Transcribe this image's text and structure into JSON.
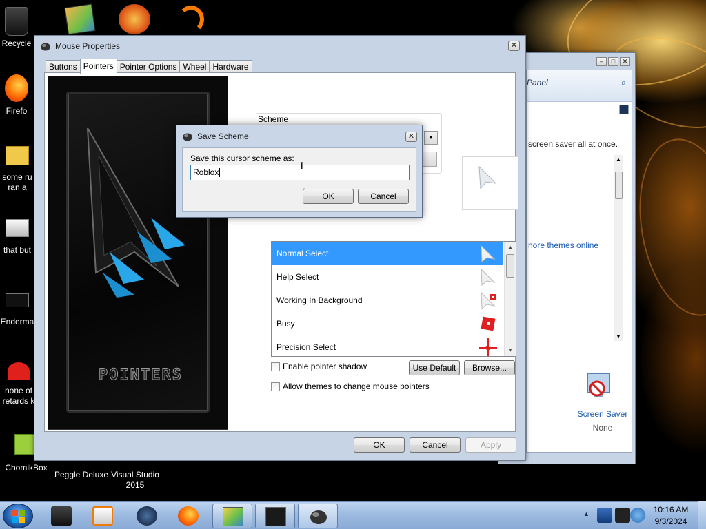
{
  "desktop": {
    "icons": [
      {
        "name": "recycle-bin",
        "label": "Recycle"
      },
      {
        "name": "firefox",
        "label": "Firefo"
      },
      {
        "name": "folder-1",
        "label": "some ru\nran a"
      },
      {
        "name": "folder-2",
        "label": "that but"
      },
      {
        "name": "enderman",
        "label": "Enderma"
      },
      {
        "name": "roblox-1",
        "label": "none of\nretards k"
      },
      {
        "name": "chomikbox",
        "label": "ChomikBox"
      },
      {
        "name": "peggle",
        "label": "Peggle Deluxe"
      },
      {
        "name": "visual-studio",
        "label": "Visual Studio\n2015"
      }
    ]
  },
  "control_panel": {
    "address_text": "Panel",
    "description_text": "screen saver all at once.",
    "link_text": "nore themes online",
    "screen_saver_label": "Screen Saver",
    "screen_saver_value": "None"
  },
  "mouse_properties": {
    "title": "Mouse Properties",
    "tabs": [
      "Buttons",
      "Pointers",
      "Pointer Options",
      "Wheel",
      "Hardware"
    ],
    "active_tab": "Pointers",
    "art_title": "POINTERS",
    "scheme_label": "Scheme",
    "customize_items": [
      {
        "label": "Normal Select",
        "selected": true,
        "icon": "arrow-cursor-icon"
      },
      {
        "label": "Help Select",
        "selected": false,
        "icon": "help-cursor-icon"
      },
      {
        "label": "Working In Background",
        "selected": false,
        "icon": "working-cursor-icon"
      },
      {
        "label": "Busy",
        "selected": false,
        "icon": "busy-cursor-icon"
      },
      {
        "label": "Precision Select",
        "selected": false,
        "icon": "crosshair-cursor-icon"
      }
    ],
    "enable_shadow_label": "Enable pointer shadow",
    "allow_themes_label": "Allow themes to change mouse pointers",
    "use_default_label": "Use Default",
    "browse_label": "Browse...",
    "ok_label": "OK",
    "cancel_label": "Cancel",
    "apply_label": "Apply"
  },
  "save_scheme": {
    "title": "Save Scheme",
    "prompt": "Save this cursor scheme as:",
    "value": "Roblox",
    "ok_label": "OK",
    "cancel_label": "Cancel"
  },
  "taskbar": {
    "items": [
      "media-player",
      "windows-media-center",
      "firefox",
      "control-panel",
      "media-window",
      "mouse-properties"
    ],
    "clock_time": "10:16 AM",
    "clock_date": "9/3/2024"
  }
}
